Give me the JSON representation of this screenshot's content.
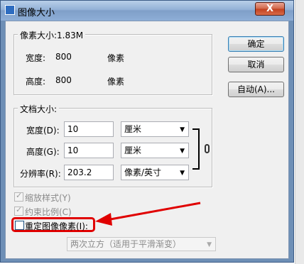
{
  "dialog": {
    "title": "图像大小",
    "close": "X"
  },
  "pixel_dimensions": {
    "label": "像素大小:1.83M",
    "width_label": "宽度:",
    "width_value": "800",
    "width_unit": "像素",
    "height_label": "高度:",
    "height_value": "800",
    "height_unit": "像素"
  },
  "buttons": {
    "ok": "确定",
    "cancel": "取消",
    "auto": "自动(A)..."
  },
  "document_size": {
    "label": "文档大小:",
    "width_label": "宽度(D):",
    "width_value": "10",
    "width_unit": "厘米",
    "height_label": "高度(G):",
    "height_value": "10",
    "height_unit": "厘米",
    "resolution_label": "分辨率(R):",
    "resolution_value": "203.2",
    "resolution_unit": "像素/英寸"
  },
  "options": {
    "scale_styles": "缩放样式(Y)",
    "constrain": "约束比例(C)",
    "resample": "重定图像像素(I):",
    "method": "两次立方（适用于平滑渐变）"
  },
  "colors": {
    "annotation": "#e00000",
    "title_bar": "#93b1d6"
  }
}
